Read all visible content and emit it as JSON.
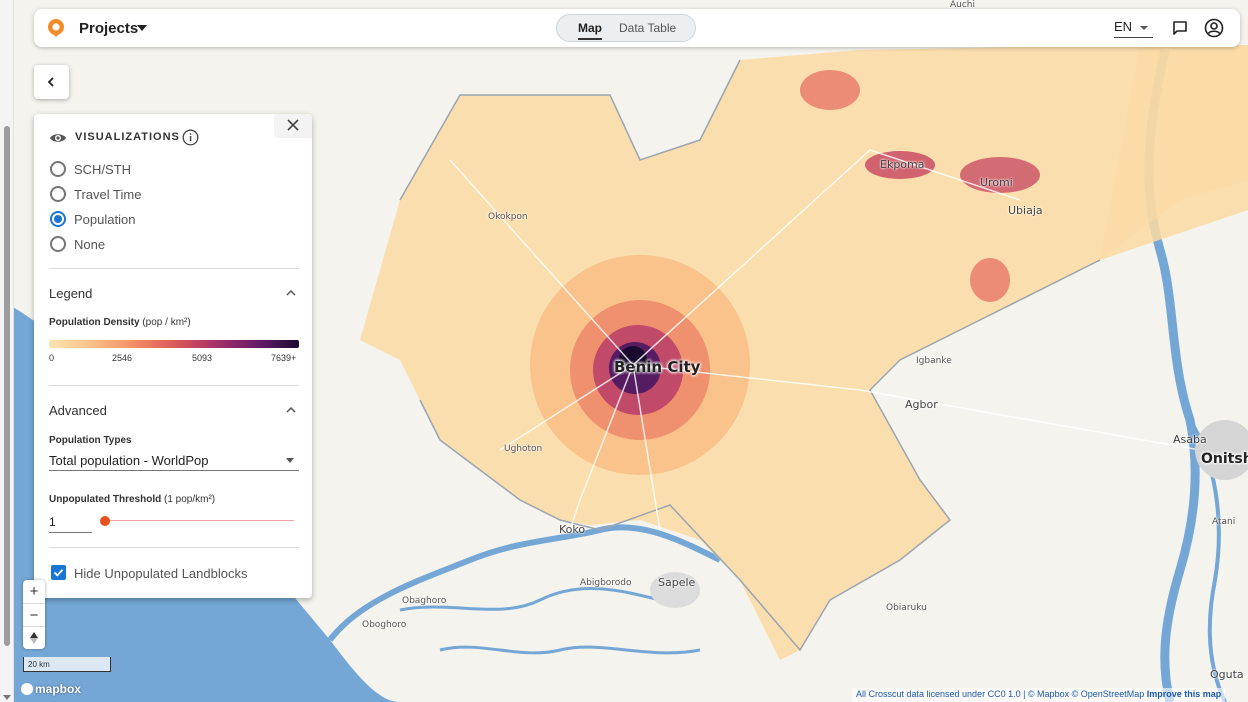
{
  "header": {
    "project_title": "Projects",
    "tabs": [
      {
        "label": "Map",
        "active": true
      },
      {
        "label": "Data Table",
        "active": false
      }
    ],
    "language": "EN"
  },
  "panel": {
    "visualizations_title": "VISUALIZATIONS",
    "options": [
      {
        "label": "SCH/STH",
        "selected": false
      },
      {
        "label": "Travel Time",
        "selected": false
      },
      {
        "label": "Population",
        "selected": true
      },
      {
        "label": "None",
        "selected": false
      }
    ],
    "legend": {
      "section_title": "Legend",
      "title": "Population Density",
      "unit": "(pop / km²)",
      "ticks": [
        "0",
        "2546",
        "5093",
        "7639+"
      ],
      "colors": [
        "#fde3b2",
        "#f79b6b",
        "#c6445f",
        "#5b1865",
        "#1a0b2e"
      ]
    },
    "advanced": {
      "section_title": "Advanced",
      "population_types_label": "Population Types",
      "population_type_value": "Total population - WorldPop",
      "threshold_label": "Unpopulated Threshold",
      "threshold_unit": "(1 pop/km²)",
      "threshold_value": "1",
      "threshold_fraction": 0.0
    },
    "hide_unpopulated": {
      "label": "Hide Unpopulated Landblocks",
      "checked": true
    }
  },
  "map": {
    "labels": {
      "benin_city": "Benin City",
      "okokpon": "Okokpon",
      "ugbotu": "Ughoton",
      "koko": "Koko",
      "abigborodo": "Abigborodo",
      "sapele": "Sapele",
      "obaghoro": "Obaghoro",
      "oboghoro": "Oboghoro",
      "agbor": "Agbor",
      "igbanke": "Igbanke",
      "ekpoma": "Ekpoma",
      "uromi": "Uromi",
      "ubiaja": "Ubiaja",
      "asaba": "Asaba",
      "onitsha": "Onitsha",
      "atani": "Atani",
      "obiaruku": "Obiaruku",
      "oguta": "Oguta",
      "auchi": "Auchi"
    },
    "scale_label": "20 km",
    "mapbox_label": "mapbox",
    "attribution": "All Crosscut data licensed under CC0 1.0 | © Mapbox © OpenStreetMap",
    "improve_link": "Improve this map",
    "water_color": "#75a7d6",
    "land_color": "#f2f1ec"
  }
}
